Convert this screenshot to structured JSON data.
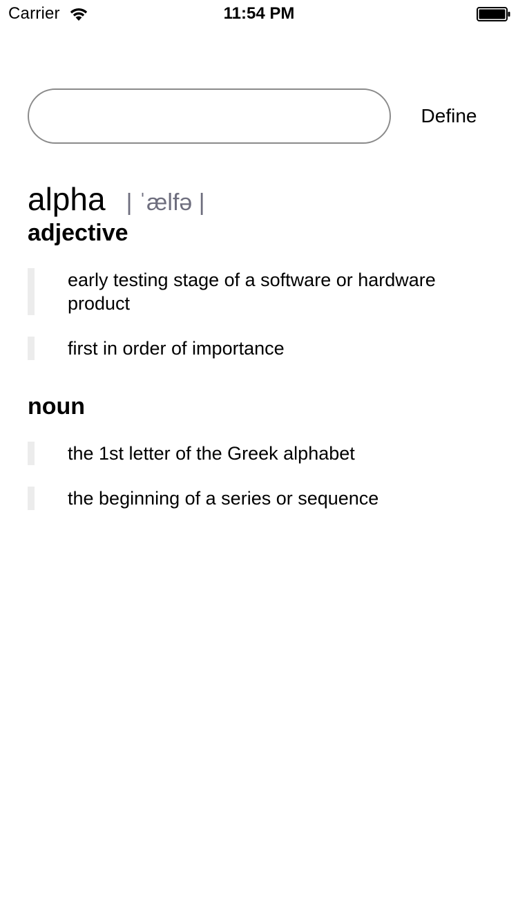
{
  "status_bar": {
    "carrier": "Carrier",
    "time": "11:54 PM",
    "icons": [
      "wifi-icon",
      "battery-icon"
    ]
  },
  "search": {
    "value": "",
    "placeholder": "",
    "button_label": "Define"
  },
  "entry": {
    "word": "alpha",
    "pronunciation": "| ˈælfə |",
    "sections": [
      {
        "part_of_speech": "adjective",
        "senses": [
          "early testing stage of a software or hardware product",
          "first in order of importance"
        ]
      },
      {
        "part_of_speech": "noun",
        "senses": [
          "the 1st letter of the Greek alphabet",
          "the beginning of a series or sequence"
        ]
      }
    ]
  },
  "colors": {
    "text": "#000000",
    "pronunciation": "#6e6e7e",
    "sense_bar": "#ececec",
    "input_border": "#8a8a8a"
  }
}
